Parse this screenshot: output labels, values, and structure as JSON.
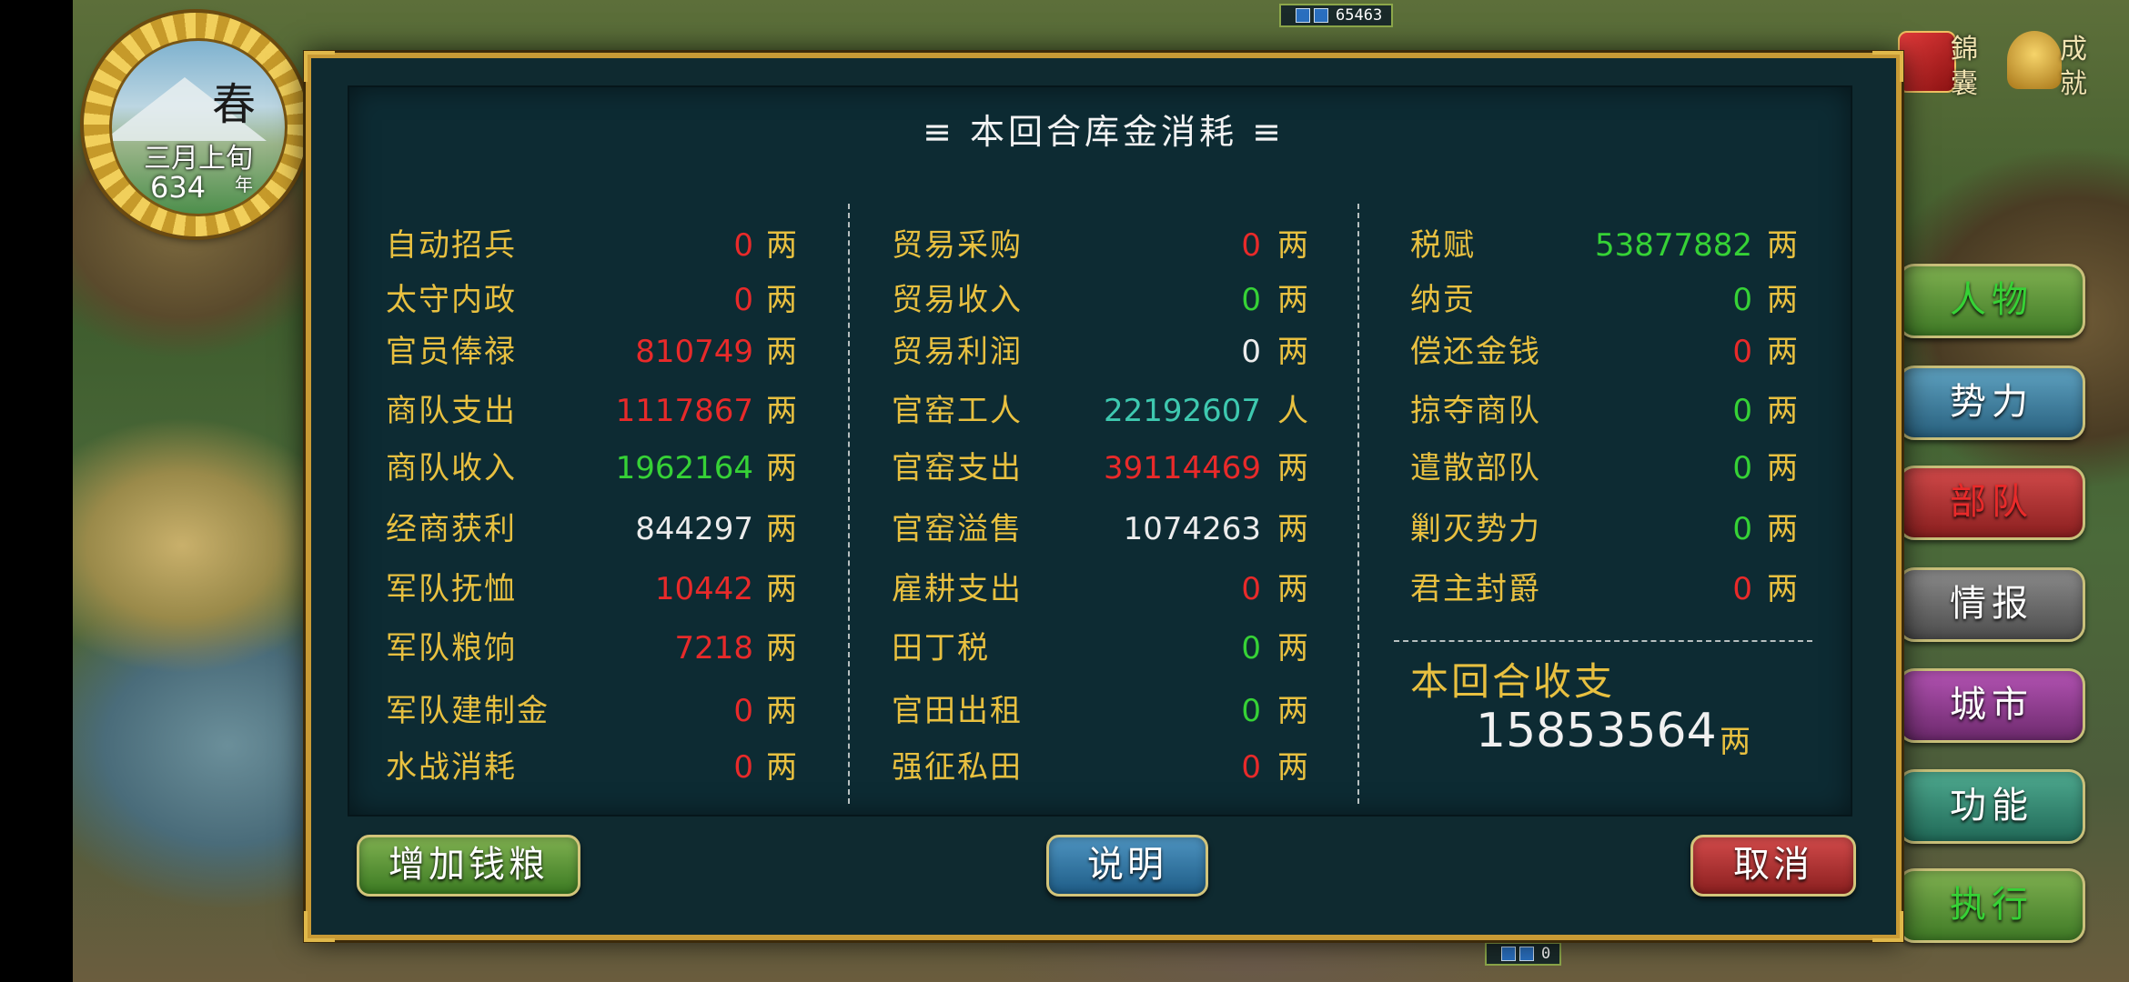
{
  "season": {
    "season": "春",
    "month": "三月上旬",
    "year": "634",
    "year_unit": "年"
  },
  "map_badges": {
    "top_value": "65463",
    "bottom_value": "0"
  },
  "top_icons": {
    "jinnang": "錦囊",
    "achievement": "成就"
  },
  "side_menu": [
    "人物",
    "势力",
    "部队",
    "情报",
    "城市",
    "功能",
    "执行"
  ],
  "dialog": {
    "title": "≡ 本回合库金消耗 ≡",
    "col1": [
      {
        "label": "自动招兵",
        "value": "0",
        "unit": "两",
        "color": "red"
      },
      {
        "label": "太守内政",
        "value": "0",
        "unit": "两",
        "color": "red"
      },
      {
        "label": "官员俸禄",
        "value": "810749",
        "unit": "两",
        "color": "red"
      },
      {
        "label": "商队支出",
        "value": "1117867",
        "unit": "两",
        "color": "red"
      },
      {
        "label": "商队收入",
        "value": "1962164",
        "unit": "两",
        "color": "green"
      },
      {
        "label": "经商获利",
        "value": "844297",
        "unit": "两",
        "color": "white"
      },
      {
        "label": "军队抚恤",
        "value": "10442",
        "unit": "两",
        "color": "red"
      },
      {
        "label": "军队粮饷",
        "value": "7218",
        "unit": "两",
        "color": "red"
      },
      {
        "label": "军队建制金",
        "value": "0",
        "unit": "两",
        "color": "red"
      },
      {
        "label": "水战消耗",
        "value": "0",
        "unit": "两",
        "color": "red"
      }
    ],
    "col2": [
      {
        "label": "贸易采购",
        "value": "0",
        "unit": "两",
        "color": "red"
      },
      {
        "label": "贸易收入",
        "value": "0",
        "unit": "两",
        "color": "green"
      },
      {
        "label": "贸易利润",
        "value": "0",
        "unit": "两",
        "color": "white"
      },
      {
        "label": "官窑工人",
        "value": "22192607",
        "unit": "人",
        "color": "cyan"
      },
      {
        "label": "官窑支出",
        "value": "39114469",
        "unit": "两",
        "color": "red"
      },
      {
        "label": "官窑溢售",
        "value": "1074263",
        "unit": "两",
        "color": "white"
      },
      {
        "label": "雇耕支出",
        "value": "0",
        "unit": "两",
        "color": "red"
      },
      {
        "label": "田丁税",
        "value": "0",
        "unit": "两",
        "color": "green"
      },
      {
        "label": "官田出租",
        "value": "0",
        "unit": "两",
        "color": "green"
      },
      {
        "label": "强征私田",
        "value": "0",
        "unit": "两",
        "color": "red"
      }
    ],
    "col3": [
      {
        "label": "税赋",
        "value": "53877882",
        "unit": "两",
        "color": "green"
      },
      {
        "label": "纳贡",
        "value": "0",
        "unit": "两",
        "color": "green"
      },
      {
        "label": "偿还金钱",
        "value": "0",
        "unit": "两",
        "color": "red"
      },
      {
        "label": "掠夺商队",
        "value": "0",
        "unit": "两",
        "color": "green"
      },
      {
        "label": "遣散部队",
        "value": "0",
        "unit": "两",
        "color": "green"
      },
      {
        "label": "剿灭势力",
        "value": "0",
        "unit": "两",
        "color": "green"
      },
      {
        "label": "君主封爵",
        "value": "0",
        "unit": "两",
        "color": "red"
      }
    ],
    "total_label": "本回合收支",
    "total_value": "15853564",
    "total_unit": "两",
    "buttons": {
      "add": "增加钱粮",
      "explain": "说明",
      "cancel": "取消"
    }
  },
  "colors": {
    "gold": "#e8c040",
    "red": "#e82a2a",
    "green": "#36d236",
    "frame": "#c89a35",
    "panel": "#0d2b33"
  }
}
